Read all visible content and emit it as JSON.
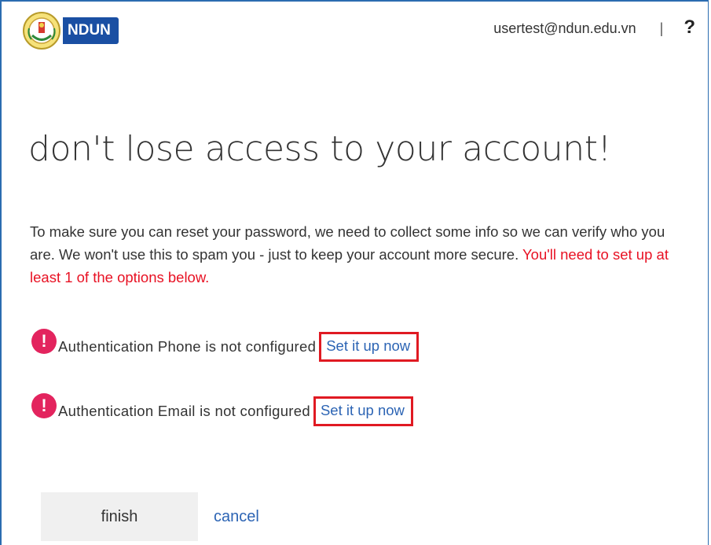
{
  "header": {
    "brand_text": "NDUN",
    "user_email": "usertest@ndun.edu.vn",
    "separator": "|",
    "help_label": "?"
  },
  "main": {
    "title": "don't lose access to your account!",
    "intro_text": "To make sure you can reset your password, we need to collect some info so we can verify who you are. We won't use this to spam you - just to keep your account more secure. ",
    "intro_warning": "You'll need to set up at least 1 of the options below.",
    "methods": [
      {
        "status": "Authentication Phone is not configured",
        "link_label": "Set it up now"
      },
      {
        "status": "Authentication Email is not configured",
        "link_label": "Set it up now"
      }
    ]
  },
  "actions": {
    "finish_label": "finish",
    "cancel_label": "cancel"
  },
  "colors": {
    "brand_blue": "#1a4fa3",
    "link_blue": "#2c64b4",
    "warning_red": "#e81123",
    "alert_pink": "#e3245e",
    "highlight_red": "#e01a22"
  },
  "icons": {
    "logo": "university-seal-icon",
    "alert": "exclamation-circle-icon"
  }
}
